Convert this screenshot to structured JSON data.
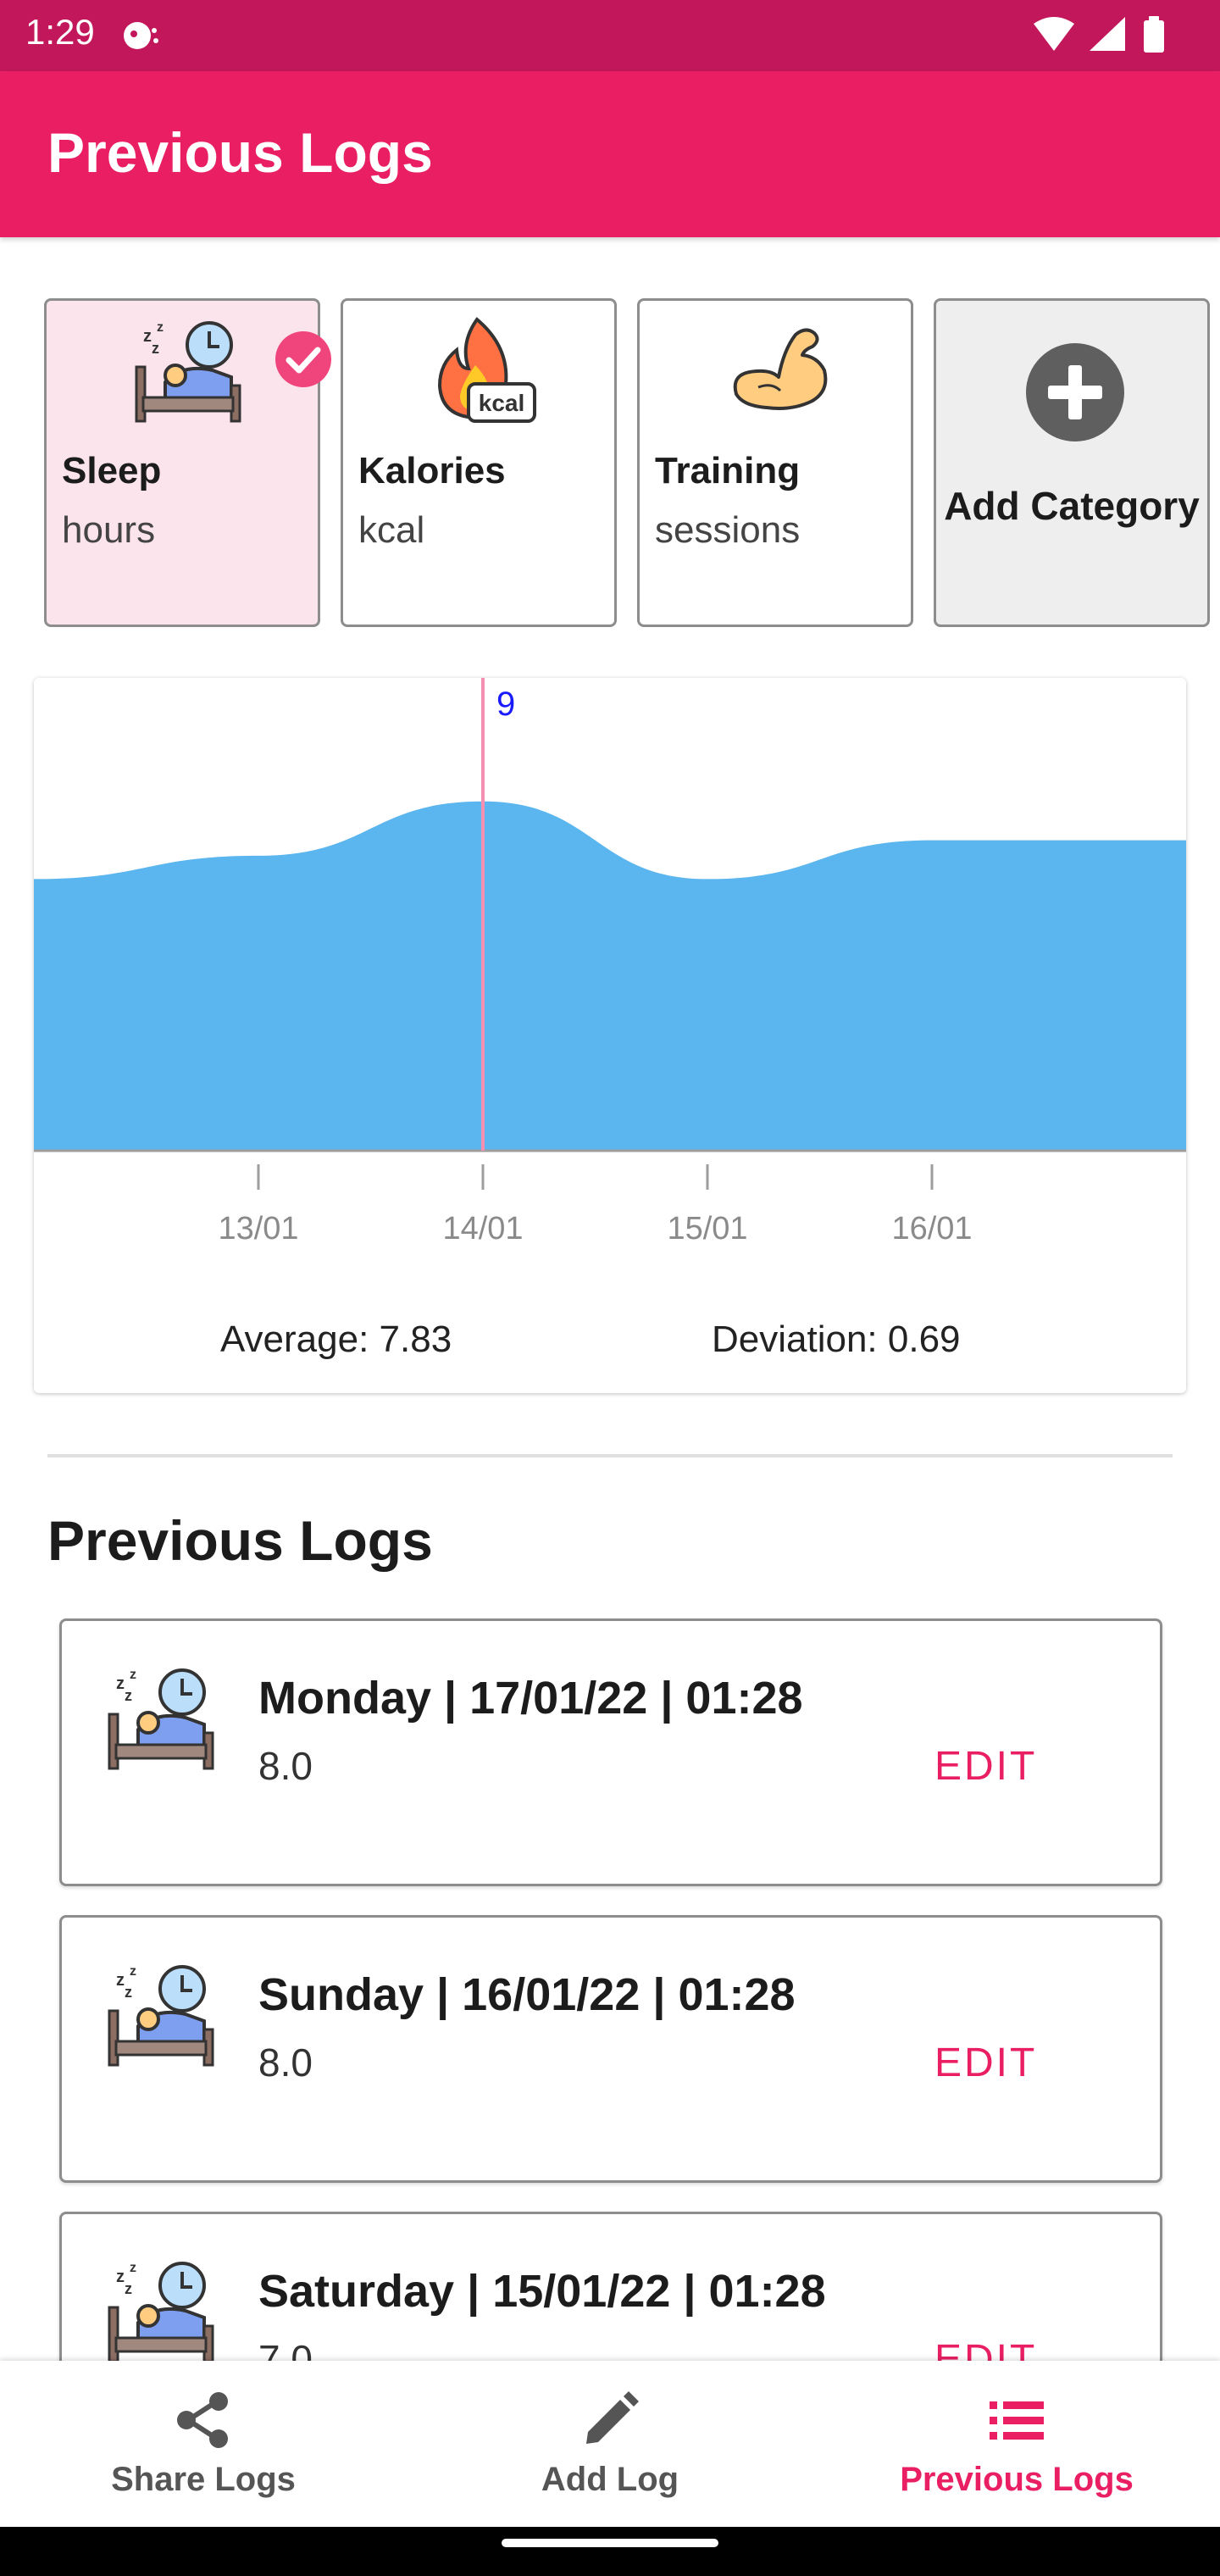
{
  "status_bar": {
    "time": "1:29"
  },
  "app_bar": {
    "title": "Previous Logs"
  },
  "categories": [
    {
      "name": "Sleep",
      "unit": "hours",
      "icon": "sleep-bed-clock-icon",
      "selected": true
    },
    {
      "name": "Kalories",
      "unit": "kcal",
      "icon": "fire-kcal-icon",
      "icon_text": "kcal",
      "selected": false
    },
    {
      "name": "Training",
      "unit": "sessions",
      "icon": "flexed-bicep-icon",
      "selected": false
    }
  ],
  "add_category": {
    "label": "Add Category",
    "icon": "plus-circle-icon"
  },
  "chart_data": {
    "type": "area",
    "x": [
      "12/01",
      "13/01",
      "14/01",
      "15/01",
      "16/01",
      "17/01"
    ],
    "tick_labels": [
      "13/01",
      "14/01",
      "15/01",
      "16/01"
    ],
    "values": [
      7.0,
      7.6,
      9.0,
      7.0,
      8.0,
      8.0
    ],
    "highlight": {
      "x": "14/01",
      "label": "9"
    },
    "fill_color": "#5bb5ee",
    "marker_color": "#f48fb1",
    "marker_label_color": "#1a1aff",
    "ylim": [
      0,
      10
    ],
    "grid": false
  },
  "stats": {
    "average": "Average: 7.83",
    "deviation": "Deviation: 0.69"
  },
  "logs_section": {
    "title": "Previous Logs"
  },
  "logs": [
    {
      "date": "Monday | 17/01/22 | 01:28",
      "value": "8.0",
      "edit": "EDIT"
    },
    {
      "date": "Sunday | 16/01/22 | 01:28",
      "value": "8.0",
      "edit": "EDIT"
    },
    {
      "date": "Saturday | 15/01/22 | 01:28",
      "value": "7.0",
      "edit": "EDIT"
    }
  ],
  "bottom_nav": [
    {
      "label": "Share Logs",
      "icon": "share-icon",
      "active": false
    },
    {
      "label": "Add Log",
      "icon": "pencil-icon",
      "active": false
    },
    {
      "label": "Previous Logs",
      "icon": "list-icon",
      "active": true
    }
  ],
  "colors": {
    "primary": "#e91e63",
    "primary_dark": "#c2185b",
    "selected_card": "#fce4ec"
  }
}
